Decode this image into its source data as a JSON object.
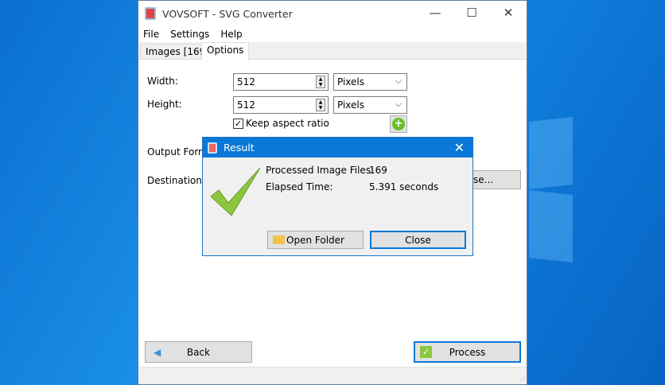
{
  "window": {
    "title": "VOVSOFT - SVG Converter"
  },
  "menu": [
    "File",
    "Settings",
    "Help"
  ],
  "tabs": [
    {
      "label": "Images [169]"
    },
    {
      "label": "Options"
    }
  ],
  "options": {
    "width_label": "Width:",
    "width_value": "512",
    "width_unit": "Pixels",
    "height_label": "Height:",
    "height_value": "512",
    "height_unit": "Pixels",
    "keep_aspect_label": "Keep aspect ratio",
    "keep_aspect_checked": true,
    "output_format_label": "Output Forma",
    "destination_label": "Destination:",
    "browse_label": "se..."
  },
  "footer": {
    "back_label": "Back",
    "process_label": "Process"
  },
  "dialog": {
    "title": "Result",
    "processed_label": "Processed Image Files:",
    "processed_value": "169",
    "elapsed_label": "Elapsed Time:",
    "elapsed_value": "5.391 seconds",
    "open_folder_label": "Open Folder",
    "close_label": "Close"
  },
  "colors": {
    "accent": "#0a78d7",
    "check": "#8cc63f"
  }
}
